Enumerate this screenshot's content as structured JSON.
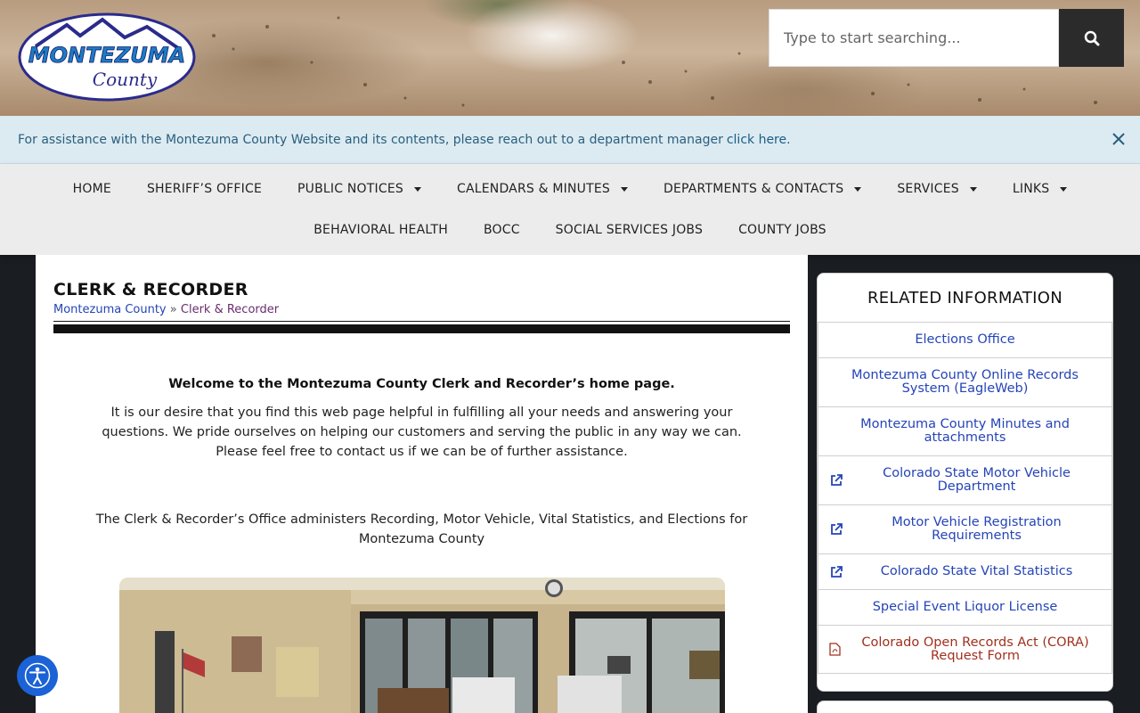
{
  "header": {
    "logo_text": "MONTEZUMA",
    "logo_sub": "County",
    "search_placeholder": "Type to start searching..."
  },
  "notice": {
    "text": "For assistance with the Montezuma County Website and its contents, please reach out to a department manager",
    "link": "click here."
  },
  "nav": {
    "row1": [
      {
        "label": "HOME",
        "dropdown": false
      },
      {
        "label": "SHERIFF’S OFFICE",
        "dropdown": false
      },
      {
        "label": "PUBLIC NOTICES",
        "dropdown": true
      },
      {
        "label": "CALENDARS & MINUTES",
        "dropdown": true
      },
      {
        "label": "DEPARTMENTS & CONTACTS",
        "dropdown": true
      },
      {
        "label": "SERVICES",
        "dropdown": true
      },
      {
        "label": "LINKS",
        "dropdown": true
      }
    ],
    "row2": [
      {
        "label": "BEHAVIORAL HEALTH",
        "dropdown": false
      },
      {
        "label": "BOCC",
        "dropdown": false
      },
      {
        "label": "SOCIAL SERVICES JOBS",
        "dropdown": false
      },
      {
        "label": "COUNTY JOBS",
        "dropdown": false
      }
    ]
  },
  "main": {
    "title": "CLERK & RECORDER",
    "breadcrumb": {
      "home": "Montezuma County",
      "separator": "»",
      "current": "Clerk & Recorder"
    },
    "welcome": "Welcome to the Montezuma County Clerk and Recorder’s home page.",
    "intro": "It is our desire that you find this web page helpful in fulfilling all your needs and answering your questions. We pride ourselves on helping our customers and serving the public in any way we can. Please feel free to contact us if we can be of further assistance.",
    "admin": "The Clerk & Recorder’s Office administers Recording, Motor Vehicle, Vital Statistics, and Elections for Montezuma County"
  },
  "sidebar": {
    "title": "RELATED INFORMATION",
    "items": [
      {
        "label": "Elections Office",
        "icon": "none"
      },
      {
        "label": "Montezuma County Online Records System (EagleWeb)",
        "icon": "none"
      },
      {
        "label": "Montezuma County Minutes and attachments",
        "icon": "none"
      },
      {
        "label": "Colorado State Motor Vehicle Department",
        "icon": "external-link-icon"
      },
      {
        "label": "Motor Vehicle Registration Requirements",
        "icon": "external-link-icon"
      },
      {
        "label": "Colorado State Vital Statistics",
        "icon": "external-link-icon"
      },
      {
        "label": "Special Event Liquor License",
        "icon": "none"
      },
      {
        "label": "Colorado Open Records Act (CORA) Request Form",
        "icon": "pdf-icon"
      }
    ]
  },
  "colors": {
    "link": "#2544b7",
    "pdf_link": "#a0301e",
    "notice_bg": "#dcebf2",
    "accessibility": "#1a62d6"
  }
}
